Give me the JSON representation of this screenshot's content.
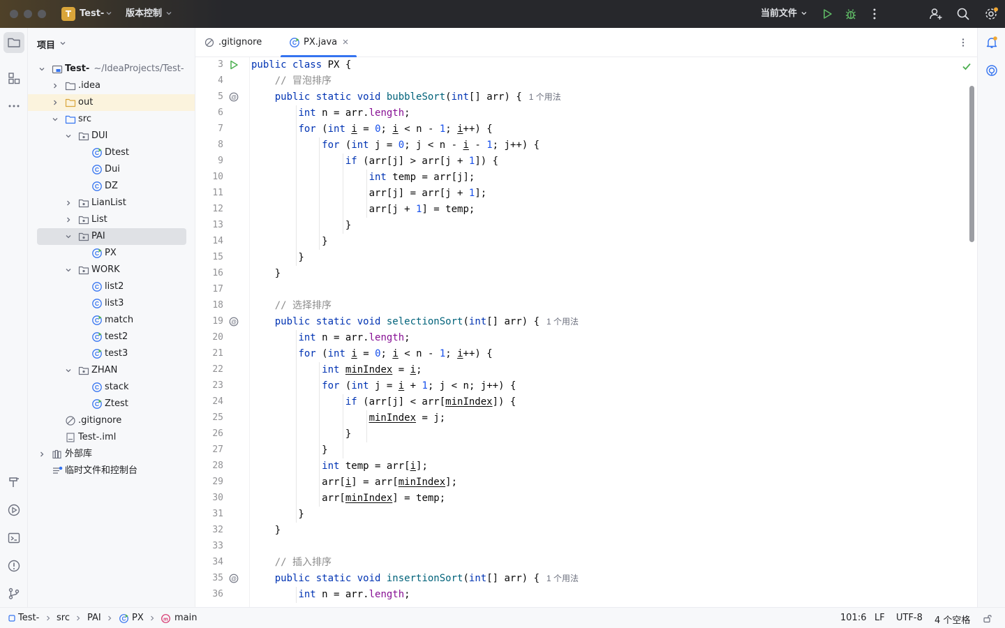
{
  "titlebar": {
    "project_badge": "T",
    "project_name": "Test-",
    "vcs_label": "版本控制",
    "run_config": "当前文件"
  },
  "project_panel": {
    "title": "项目",
    "tree": [
      {
        "label": "Test-",
        "sub": "~/IdeaProjects/Test-",
        "icon": "module-folder-icon",
        "expanded": true
      },
      {
        "label": ".idea",
        "icon": "folder-icon",
        "expanded": false
      },
      {
        "label": "out",
        "icon": "folder-orange-icon",
        "expanded": false
      },
      {
        "label": "src",
        "icon": "source-folder-icon",
        "expanded": true
      },
      {
        "label": "DUI",
        "icon": "package-icon",
        "expanded": true
      },
      {
        "label": "Dtest",
        "icon": "class-runnable-icon"
      },
      {
        "label": "Dui",
        "icon": "class-icon"
      },
      {
        "label": "DZ",
        "icon": "class-icon"
      },
      {
        "label": "LianList",
        "icon": "package-icon",
        "expanded": false
      },
      {
        "label": "List",
        "icon": "package-icon",
        "expanded": false
      },
      {
        "label": "PAI",
        "icon": "package-icon",
        "expanded": true
      },
      {
        "label": "PX",
        "icon": "class-runnable-icon"
      },
      {
        "label": "WORK",
        "icon": "package-icon",
        "expanded": true
      },
      {
        "label": "list2",
        "icon": "class-icon"
      },
      {
        "label": "list3",
        "icon": "class-icon"
      },
      {
        "label": "match",
        "icon": "class-runnable-icon"
      },
      {
        "label": "test2",
        "icon": "class-runnable-icon"
      },
      {
        "label": "test3",
        "icon": "class-runnable-icon"
      },
      {
        "label": "ZHAN",
        "icon": "package-icon",
        "expanded": true
      },
      {
        "label": "stack",
        "icon": "class-icon"
      },
      {
        "label": "Ztest",
        "icon": "class-runnable-icon"
      },
      {
        "label": ".gitignore",
        "icon": "ignore-file-icon"
      },
      {
        "label": "Test-.iml",
        "icon": "iml-file-icon"
      },
      {
        "label": "外部库",
        "icon": "library-icon",
        "expanded": false
      },
      {
        "label": "临时文件和控制台",
        "icon": "scratch-icon"
      }
    ]
  },
  "editor": {
    "tabs": [
      {
        "label": ".gitignore",
        "active": false
      },
      {
        "label": "PX.java",
        "active": true
      }
    ],
    "usage_hint": "1 个用法",
    "lines": [
      {
        "n": "3"
      },
      {
        "n": "4"
      },
      {
        "n": "5"
      },
      {
        "n": "6"
      },
      {
        "n": "7"
      },
      {
        "n": "8"
      },
      {
        "n": "9"
      },
      {
        "n": "10"
      },
      {
        "n": "11"
      },
      {
        "n": "12"
      },
      {
        "n": "13"
      },
      {
        "n": "14"
      },
      {
        "n": "15"
      },
      {
        "n": "16"
      },
      {
        "n": "17"
      },
      {
        "n": "18"
      },
      {
        "n": "19"
      },
      {
        "n": "20"
      },
      {
        "n": "21"
      },
      {
        "n": "22"
      },
      {
        "n": "23"
      },
      {
        "n": "24"
      },
      {
        "n": "25"
      },
      {
        "n": "26"
      },
      {
        "n": "27"
      },
      {
        "n": "28"
      },
      {
        "n": "29"
      },
      {
        "n": "30"
      },
      {
        "n": "31"
      },
      {
        "n": "32"
      },
      {
        "n": "33"
      },
      {
        "n": "34"
      },
      {
        "n": "35"
      },
      {
        "n": "36"
      }
    ],
    "code": {
      "class_decl_kw": "public class",
      "class_name": "PX {",
      "comment_bubble": "// 冒泡排序",
      "comment_selection": "// 选择排序",
      "comment_insertion": "// 插入排序",
      "method_modifiers": "public static void",
      "bubble_sort": "bubbleSort",
      "selection_sort": "selectionSort",
      "insertion_sort": "insertionSort",
      "param_list_kw": "int",
      "param_list_rest": "[] arr) {"
    }
  },
  "statusbar": {
    "breadcrumbs": [
      "Test-",
      "src",
      "PAI",
      "PX",
      "main"
    ],
    "position": "101:6",
    "line_sep": "LF",
    "encoding": "UTF-8",
    "indent": "4 个空格"
  },
  "colors": {
    "accent": "#3574f0",
    "keyword": "#0033b3",
    "method": "#00627a",
    "field": "#871094",
    "number": "#1750eb",
    "comment": "#8c8c8c",
    "run_green": "#4caf50"
  }
}
